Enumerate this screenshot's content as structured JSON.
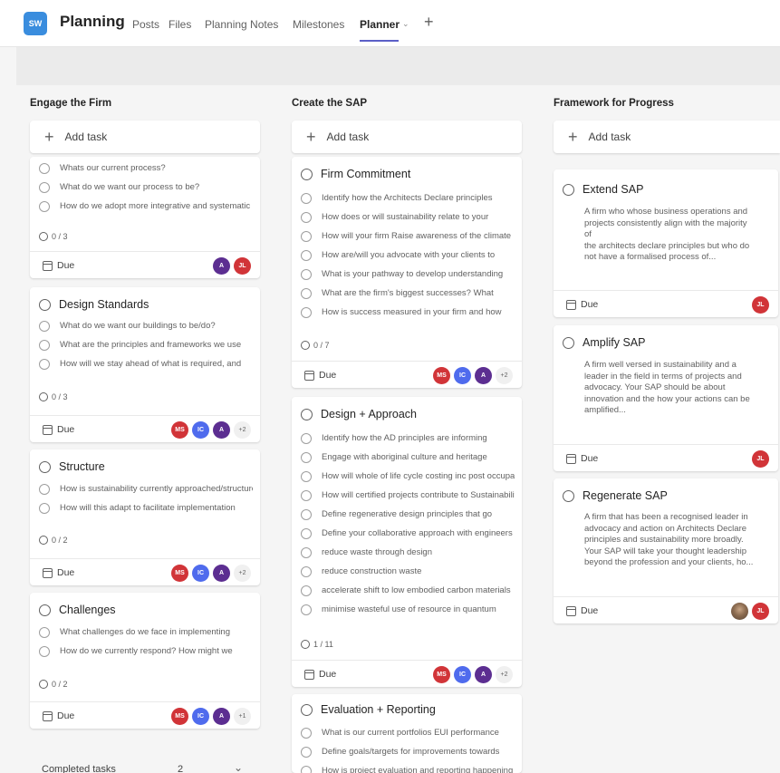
{
  "header": {
    "logo_text": "SW",
    "title": "Planning",
    "tabs": [
      {
        "label": "Posts"
      },
      {
        "label": "Files"
      },
      {
        "label": "Planning Notes"
      },
      {
        "label": "Milestones"
      },
      {
        "label": "Planner"
      }
    ],
    "add_tab_icon": "plus-icon"
  },
  "columns": [
    {
      "title": "Engage the Firm",
      "add_task": "Add task",
      "completed_label": "Completed tasks",
      "completed_count": "2",
      "cards": [
        {
          "items": [
            "Whats our current process?",
            "What do we want our process to be?",
            "How do we adopt more integrative and systematic"
          ],
          "progress": "0 / 3",
          "due": "Due",
          "avatars": [
            {
              "text": "A",
              "color": "#5c2e91"
            },
            {
              "text": "JL",
              "color": "#d13438"
            }
          ]
        },
        {
          "title": "Design Standards",
          "items": [
            "What do we want our buildings to be/do?",
            "What are the principles and frameworks we use",
            "How will we stay ahead of what is required, and"
          ],
          "progress": "0 / 3",
          "due": "Due",
          "avatars": [
            {
              "text": "MS",
              "color": "#d13438"
            },
            {
              "text": "IC",
              "color": "#4f6bed"
            },
            {
              "text": "A",
              "color": "#5c2e91"
            },
            {
              "text": "+2",
              "more": true
            }
          ]
        },
        {
          "title": "Structure",
          "items": [
            "How is sustainability currently approached/structured",
            "How will this adapt to facilitate implementation"
          ],
          "progress": "0 / 2",
          "due": "Due",
          "avatars": [
            {
              "text": "MS",
              "color": "#d13438"
            },
            {
              "text": "IC",
              "color": "#4f6bed"
            },
            {
              "text": "A",
              "color": "#5c2e91"
            },
            {
              "text": "+2",
              "more": true
            }
          ]
        },
        {
          "title": "Challenges",
          "items": [
            "What challenges do we face in implementing",
            "How do we currently respond? How might we"
          ],
          "progress": "0 / 2",
          "due": "Due",
          "avatars": [
            {
              "text": "MS",
              "color": "#d13438"
            },
            {
              "text": "IC",
              "color": "#4f6bed"
            },
            {
              "text": "A",
              "color": "#5c2e91"
            },
            {
              "text": "+1",
              "more": true
            }
          ]
        }
      ]
    },
    {
      "title": "Create the SAP",
      "add_task": "Add task",
      "cards": [
        {
          "title": "Firm Commitment",
          "items": [
            "Identify how the Architects Declare principles",
            "How does or will sustainability relate to your",
            "How will your firm Raise awareness of the climate",
            "How are/will you advocate with your clients to",
            "What is your pathway to develop understanding",
            "What are the firm's biggest successes? What",
            "How is success measured in your firm and how"
          ],
          "progress": "0 / 7",
          "due": "Due",
          "avatars": [
            {
              "text": "MS",
              "color": "#d13438"
            },
            {
              "text": "IC",
              "color": "#4f6bed"
            },
            {
              "text": "A",
              "color": "#5c2e91"
            },
            {
              "text": "+2",
              "more": true
            }
          ]
        },
        {
          "title": "Design + Approach",
          "items": [
            "Identify how the AD principles are informing",
            "Engage with aboriginal culture and heritage",
            "How will whole of life cycle costing inc post occupancy",
            "How will certified projects contribute to Sustainability",
            "Define regenerative design principles that go",
            "Define your collaborative approach with engineers",
            "reduce waste through design",
            "reduce construction waste",
            "accelerate shift to low embodied carbon materials",
            "minimise wasteful use of resource in quantum"
          ],
          "progress": "1 / 11",
          "due": "Due",
          "avatars": [
            {
              "text": "MS",
              "color": "#d13438"
            },
            {
              "text": "IC",
              "color": "#4f6bed"
            },
            {
              "text": "A",
              "color": "#5c2e91"
            },
            {
              "text": "+2",
              "more": true
            }
          ]
        },
        {
          "title": "Evaluation + Reporting",
          "items": [
            "What is our current portfolios EUI performance",
            "Define goals/targets for improvements towards",
            "How is project evaluation and reporting happening"
          ]
        }
      ]
    },
    {
      "title": "Framework for Progress",
      "add_task": "Add task",
      "cards": [
        {
          "title": "Extend SAP",
          "desc": [
            "A firm who whose business operations and",
            "projects consistently align with the majority",
            "of",
            "the architects declare principles but who do",
            "not have a formalised process of..."
          ],
          "due": "Due",
          "avatars": [
            {
              "text": "JL",
              "color": "#d13438"
            }
          ]
        },
        {
          "title": "Amplify SAP",
          "desc": [
            "A firm well versed in sustainability and a",
            "leader in the field in terms of projects and",
            "advocacy. Your SAP should be about",
            "innovation and the how your actions can be",
            "amplified..."
          ],
          "due": "Due",
          "avatars": [
            {
              "text": "JL",
              "color": "#d13438"
            }
          ]
        },
        {
          "title": "Regenerate SAP",
          "desc": [
            "A firm that has been a recognised leader in",
            "advocacy and action on Architects Declare",
            "principles and sustainability more broadly.",
            "Your SAP will take your thought leadership",
            "beyond the profession and your clients, ho..."
          ],
          "due": "Due",
          "avatars": [
            {
              "photo": true
            },
            {
              "text": "JL",
              "color": "#d13438"
            }
          ]
        }
      ]
    }
  ]
}
